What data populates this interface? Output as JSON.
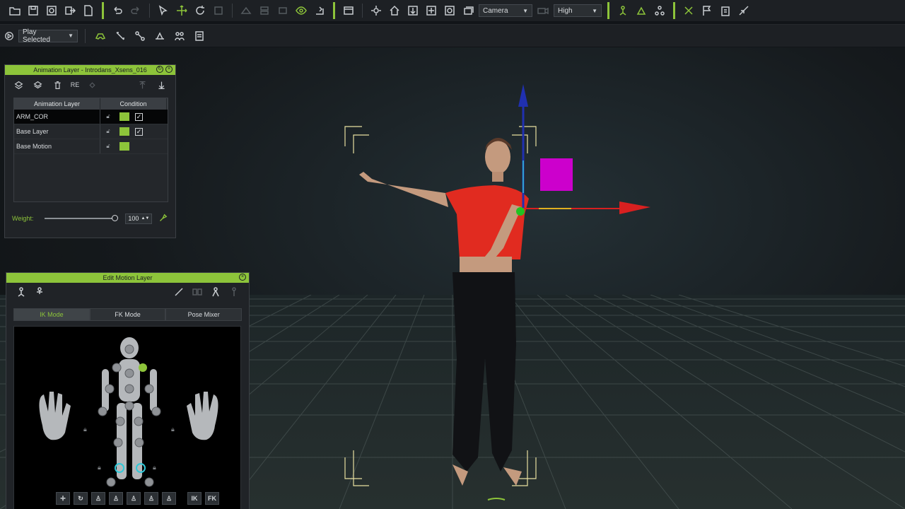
{
  "toolbar": {
    "camera_select": "Camera",
    "quality_select": "High",
    "play_select": "Play Selected"
  },
  "animation_layer": {
    "title": "Animation Layer - Introdans_Xsens_016",
    "col_name": "Animation Layer",
    "col_condition": "Condition",
    "rows": [
      {
        "name": "ARM_COR",
        "checked": true
      },
      {
        "name": "Base Layer",
        "checked": true
      },
      {
        "name": "Base Motion",
        "checked": false
      }
    ],
    "weight_label": "Weight:",
    "weight_value": "100",
    "re_label": "RE"
  },
  "edit_motion": {
    "title": "Edit Motion Layer",
    "tabs": [
      "IK Mode",
      "FK Mode",
      "Pose Mixer"
    ],
    "ik_label": "IK",
    "fk_label": "FK"
  },
  "colors": {
    "accent": "#8dc43a",
    "magenta": "#cc00cc",
    "axis_x": "#d82020",
    "axis_y": "#2030b0"
  }
}
